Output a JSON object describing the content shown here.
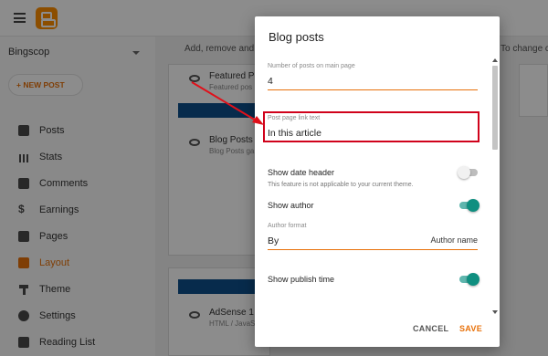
{
  "app": {
    "blog_name": "Bingscop",
    "new_post_label": "+ NEW POST",
    "nav": [
      {
        "label": "Posts",
        "icon": "posts-icon",
        "active": false
      },
      {
        "label": "Stats",
        "icon": "stats-icon",
        "active": false
      },
      {
        "label": "Comments",
        "icon": "comments-icon",
        "active": false
      },
      {
        "label": "Earnings",
        "icon": "dollar-icon",
        "active": false
      },
      {
        "label": "Pages",
        "icon": "pages-icon",
        "active": false
      },
      {
        "label": "Layout",
        "icon": "layout-icon",
        "active": true
      },
      {
        "label": "Theme",
        "icon": "theme-icon",
        "active": false
      },
      {
        "label": "Settings",
        "icon": "gear-icon",
        "active": false
      },
      {
        "label": "Reading List",
        "icon": "bookmark-icon",
        "active": false
      }
    ],
    "main_hint_left": "Add, remove and",
    "main_hint_right": "To change c",
    "gadgets": [
      {
        "title": "Featured Po",
        "subtitle": "Featured pos"
      },
      {
        "title": "Blog Posts",
        "subtitle": "Blog Posts ga"
      },
      {
        "title": "AdSense 1",
        "subtitle": "HTML / JavaS"
      }
    ],
    "accent": "#e8710a"
  },
  "dialog": {
    "title": "Blog posts",
    "posts_count": {
      "label": "Number of posts on main page",
      "value": "4"
    },
    "link_text": {
      "label": "Post page link text",
      "value": "In this article"
    },
    "show_date_header": {
      "label": "Show date header",
      "on": false,
      "note": "This feature is not applicable to your current theme."
    },
    "show_author": {
      "label": "Show author",
      "on": true
    },
    "author_format": {
      "label": "Author format",
      "value": "By",
      "suffix": "Author name"
    },
    "show_publish_time": {
      "label": "Show publish time",
      "on": true
    },
    "cancel_label": "CANCEL",
    "save_label": "SAVE",
    "toggle_on_color": "#0f8f80",
    "highlight_color": "#d0021b"
  }
}
